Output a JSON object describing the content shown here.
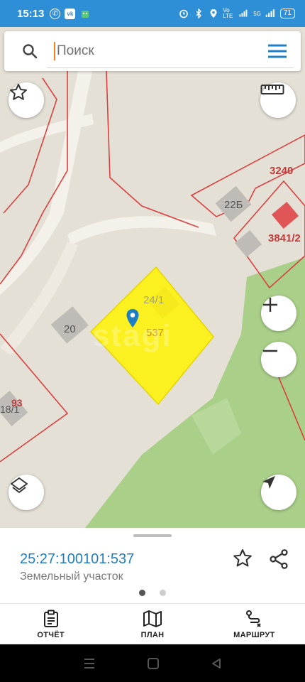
{
  "status_bar": {
    "time": "15:13",
    "network": "Vo LTE",
    "signal": "5G",
    "battery": "71"
  },
  "search": {
    "placeholder": "Поиск"
  },
  "map": {
    "parcel_labels": {
      "main": "537",
      "building_241": "24/1",
      "building_20": "20",
      "building_22b": "22Б",
      "parcel_3240": "3240",
      "parcel_3841": "3841/2",
      "parcel_93": "93",
      "building_18": "18/1"
    },
    "watermark": "stagi",
    "colors": {
      "background": "#e4e0d6",
      "parcel_fill": "#fff200",
      "parcel_border": "#d94141",
      "green": "#a9cf88",
      "road": "#f4f1ea",
      "building": "#bfbcb8",
      "marker": "#1f7fc4"
    }
  },
  "panel": {
    "cadastral_number": "25:27:100101:537",
    "object_type": "Земельный участок"
  },
  "nav": {
    "report": "ОТЧЁТ",
    "plan": "ПЛАН",
    "route": "МАРШРУТ"
  }
}
